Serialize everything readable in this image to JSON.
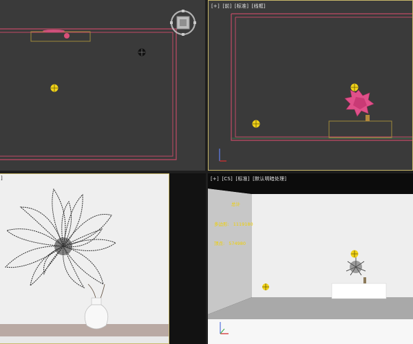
{
  "app": {
    "name": "3ds Max viewports"
  },
  "viewports": {
    "top_left": {
      "label_parts": []
    },
    "top_right": {
      "label_parts": [
        "[+]",
        "[前]",
        "[标准]",
        "[线框]"
      ]
    },
    "bottom_left": {
      "label_parts": [
        "]"
      ]
    },
    "bottom_right": {
      "label_parts": [
        "[+]",
        "[CS]",
        "[标准]",
        "[默认明暗处理]"
      ]
    }
  },
  "stats": {
    "title": "总计",
    "rows": [
      {
        "label": "多边形:",
        "value": "1119180"
      },
      {
        "label": "顶点:",
        "value": "574980"
      }
    ]
  },
  "icons": {
    "viewcube": "viewcube-icon",
    "light": "omni-light-icon",
    "axis": "axis-tripod-icon"
  },
  "colors": {
    "viewport_bg": "#3a3a3a",
    "active_border": "#c9b96a",
    "wall_line": "#d04060",
    "flower": "#e0508a",
    "light_yellow": "#f0d21a",
    "render_bg": "#efefef",
    "table_color": "#b9a9a3",
    "vase_color": "#f4f4f4"
  }
}
